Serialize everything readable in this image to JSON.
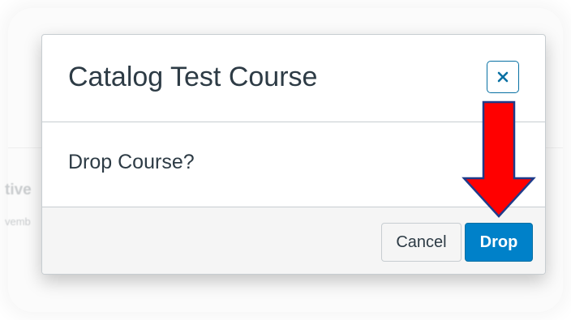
{
  "background": {
    "partial_text_1": "tive",
    "partial_text_2": "vemb"
  },
  "modal": {
    "title": "Catalog Test Course",
    "close_label": "×",
    "body_text": "Drop Course?",
    "cancel_label": "Cancel",
    "drop_label": "Drop"
  },
  "icons": {
    "close": "close-icon",
    "annotation": "down-arrow-icon"
  },
  "colors": {
    "primary_button": "#0081c9",
    "primary_border": "#0770a3",
    "text": "#2d3b45",
    "annotation_fill": "#ff0000",
    "annotation_stroke": "#1f3b8a"
  }
}
